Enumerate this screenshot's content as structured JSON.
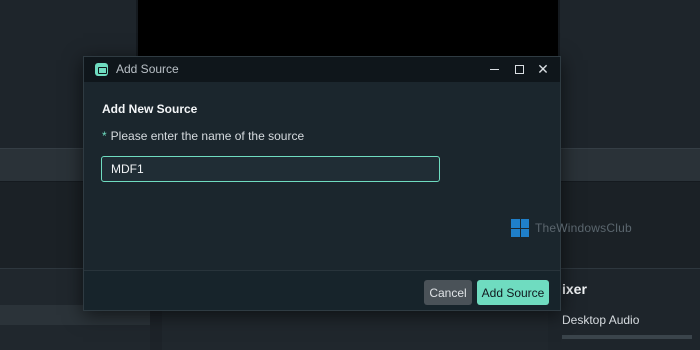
{
  "dialog": {
    "title": "Add Source",
    "heading": "Add New Source",
    "field_label": "Please enter the name of the source",
    "required_marker": "*",
    "input_value": "MDF1",
    "cancel_label": "Cancel",
    "submit_label": "Add Source"
  },
  "window_controls": {
    "minimize_icon": "minimize-icon",
    "maximize_icon": "maximize-icon",
    "close_icon": "close-icon",
    "close_glyph": "✕"
  },
  "background_app": {
    "mixer_title": "ixer",
    "mixer_item": "Desktop Audio"
  },
  "watermark": {
    "text": "TheWindowsClub"
  },
  "colors": {
    "accent": "#6fdcc0",
    "dialog_bg": "#1b262d",
    "titlebar_bg": "#0f161b",
    "cancel_bg": "#4a5258"
  }
}
